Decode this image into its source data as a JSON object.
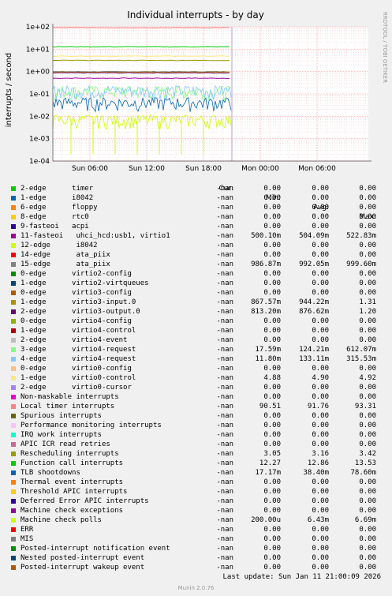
{
  "chart_data": {
    "type": "line",
    "title": "Individual interrupts - by day",
    "ylabel": "interrupts / second",
    "yscale": "log",
    "ylim": [
      0.0001,
      100
    ],
    "y_ticks": [
      "1e-04",
      "1e-03",
      "1e-02",
      "1e-01",
      "1e+00",
      "1e+01",
      "1e+02"
    ],
    "x_ticks": [
      "Sun 06:00",
      "Sun 12:00",
      "Sun 18:00",
      "Mon 00:00",
      "Mon 06:00"
    ],
    "grid": true,
    "series": [
      {
        "name": "2-edge",
        "level": 0
      },
      {
        "name": "11-fasteoi",
        "level": 0.504
      },
      {
        "name": "15-edge",
        "level": 0.992
      },
      {
        "name": "1-edge",
        "level": 0.944
      },
      {
        "name": "2-edge",
        "level": 0.877
      },
      {
        "name": "3-edge",
        "level": 0.124
      },
      {
        "name": "4-edge",
        "level": 0.133
      },
      {
        "name": "1-edge",
        "level": 4.9
      },
      {
        "name": "Local timer interrupts",
        "level": 91.76
      },
      {
        "name": "Rescheduling interrupts",
        "level": 3.16
      },
      {
        "name": "Function call interrupts",
        "level": 12.86
      },
      {
        "name": "TLB shootdowns",
        "level": 0.0384
      },
      {
        "name": "Machine check polls",
        "level": 0.00643
      }
    ]
  },
  "colors": {
    "background": "#f0f0f0",
    "plot_bg": "#ffffff",
    "grid": "#ff8080",
    "now_line": "#b0a0d0"
  },
  "legend": {
    "headers": {
      "cur": "Cur:",
      "min": "Min:",
      "avg": "Avg:",
      "max": "Max:"
    },
    "rows": [
      {
        "label": "2-edge      timer",
        "color": "#00cc00",
        "cur": "-nan",
        "min": "0.00",
        "avg": "0.00",
        "max": "0.00"
      },
      {
        "label": "1-edge      i8042",
        "color": "#0066b3",
        "cur": "-nan",
        "min": "0.00",
        "avg": "0.00",
        "max": "0.00"
      },
      {
        "label": "6-edge      floppy",
        "color": "#ff8000",
        "cur": "-nan",
        "min": "0.00",
        "avg": "0.00",
        "max": "0.00"
      },
      {
        "label": "8-edge      rtc0",
        "color": "#ffcc00",
        "cur": "-nan",
        "min": "0.00",
        "avg": "0.00",
        "max": "0.00"
      },
      {
        "label": "9-fasteoi   acpi",
        "color": "#330099",
        "cur": "-nan",
        "min": "0.00",
        "avg": "0.00",
        "max": "0.00"
      },
      {
        "label": "11-fasteoi   uhci_hcd:usb1, virtio1",
        "color": "#990099",
        "cur": "-nan",
        "min": "500.10m",
        "avg": "504.09m",
        "max": "522.83m"
      },
      {
        "label": "12-edge      i8042",
        "color": "#ccff00",
        "cur": "-nan",
        "min": "0.00",
        "avg": "0.00",
        "max": "0.00"
      },
      {
        "label": "14-edge      ata_piix",
        "color": "#ff0000",
        "cur": "-nan",
        "min": "0.00",
        "avg": "0.00",
        "max": "0.00"
      },
      {
        "label": "15-edge      ata_piix",
        "color": "#808080",
        "cur": "-nan",
        "min": "986.87m",
        "avg": "992.05m",
        "max": "999.60m"
      },
      {
        "label": "0-edge      virtio2-config",
        "color": "#008f00",
        "cur": "-nan",
        "min": "0.00",
        "avg": "0.00",
        "max": "0.00"
      },
      {
        "label": "1-edge      virtio2-virtqueues",
        "color": "#00487d",
        "cur": "-nan",
        "min": "0.00",
        "avg": "0.00",
        "max": "0.00"
      },
      {
        "label": "0-edge      virtio3-config",
        "color": "#b35a00",
        "cur": "-nan",
        "min": "0.00",
        "avg": "0.00",
        "max": "0.00"
      },
      {
        "label": "1-edge      virtio3-input.0",
        "color": "#b38f00",
        "cur": "-nan",
        "min": "867.57m",
        "avg": "944.22m",
        "max": "1.31"
      },
      {
        "label": "2-edge      virtio3-output.0",
        "color": "#6b006b",
        "cur": "-nan",
        "min": "813.20m",
        "avg": "876.62m",
        "max": "1.20"
      },
      {
        "label": "0-edge      virtio4-config",
        "color": "#8fb300",
        "cur": "-nan",
        "min": "0.00",
        "avg": "0.00",
        "max": "0.00"
      },
      {
        "label": "1-edge      virtio4-control",
        "color": "#b30000",
        "cur": "-nan",
        "min": "0.00",
        "avg": "0.00",
        "max": "0.00"
      },
      {
        "label": "2-edge      virtio4-event",
        "color": "#bebebe",
        "cur": "-nan",
        "min": "0.00",
        "avg": "0.00",
        "max": "0.00"
      },
      {
        "label": "3-edge      virtio4-request",
        "color": "#80ff80",
        "cur": "-nan",
        "min": "17.59m",
        "avg": "124.21m",
        "max": "612.07m"
      },
      {
        "label": "4-edge      virtio4-request",
        "color": "#80c9ff",
        "cur": "-nan",
        "min": "11.80m",
        "avg": "133.11m",
        "max": "315.53m"
      },
      {
        "label": "0-edge      virtio0-config",
        "color": "#ffc080",
        "cur": "-nan",
        "min": "0.00",
        "avg": "0.00",
        "max": "0.00"
      },
      {
        "label": "1-edge      virtio0-control",
        "color": "#ffe680",
        "cur": "-nan",
        "min": "4.88",
        "avg": "4.90",
        "max": "4.92"
      },
      {
        "label": "2-edge      virtio0-cursor",
        "color": "#aa80ff",
        "cur": "-nan",
        "min": "0.00",
        "avg": "0.00",
        "max": "0.00"
      },
      {
        "label": "Non-maskable interrupts",
        "color": "#ee00cc",
        "cur": "-nan",
        "min": "0.00",
        "avg": "0.00",
        "max": "0.00"
      },
      {
        "label": "Local timer interrupts",
        "color": "#ff8080",
        "cur": "-nan",
        "min": "90.51",
        "avg": "91.76",
        "max": "93.31"
      },
      {
        "label": "Spurious interrupts",
        "color": "#666600",
        "cur": "-nan",
        "min": "0.00",
        "avg": "0.00",
        "max": "0.00"
      },
      {
        "label": "Performance monitoring interrupts",
        "color": "#ffbfff",
        "cur": "-nan",
        "min": "0.00",
        "avg": "0.00",
        "max": "0.00"
      },
      {
        "label": "IRQ work interrupts",
        "color": "#00ffcc",
        "cur": "-nan",
        "min": "0.00",
        "avg": "0.00",
        "max": "0.00"
      },
      {
        "label": "APIC ICR read retries",
        "color": "#cc6699",
        "cur": "-nan",
        "min": "0.00",
        "avg": "0.00",
        "max": "0.00"
      },
      {
        "label": "Rescheduling interrupts",
        "color": "#999900",
        "cur": "-nan",
        "min": "3.05",
        "avg": "3.16",
        "max": "3.42"
      },
      {
        "label": "Function call interrupts",
        "color": "#00cc00",
        "cur": "-nan",
        "min": "12.27",
        "avg": "12.86",
        "max": "13.53"
      },
      {
        "label": "TLB shootdowns",
        "color": "#0066b3",
        "cur": "-nan",
        "min": "17.17m",
        "avg": "38.40m",
        "max": "78.60m"
      },
      {
        "label": "Thermal event interrupts",
        "color": "#ff8000",
        "cur": "-nan",
        "min": "0.00",
        "avg": "0.00",
        "max": "0.00"
      },
      {
        "label": "Threshold APIC interrupts",
        "color": "#ffcc00",
        "cur": "-nan",
        "min": "0.00",
        "avg": "0.00",
        "max": "0.00"
      },
      {
        "label": "Deferred Error APIC interrupts",
        "color": "#330099",
        "cur": "-nan",
        "min": "0.00",
        "avg": "0.00",
        "max": "0.00"
      },
      {
        "label": "Machine check exceptions",
        "color": "#990099",
        "cur": "-nan",
        "min": "0.00",
        "avg": "0.00",
        "max": "0.00"
      },
      {
        "label": "Machine check polls",
        "color": "#ccff00",
        "cur": "-nan",
        "min": "200.00u",
        "avg": "6.43m",
        "max": "6.69m"
      },
      {
        "label": "ERR",
        "color": "#ff0000",
        "cur": "-nan",
        "min": "0.00",
        "avg": "0.00",
        "max": "0.00"
      },
      {
        "label": "MIS",
        "color": "#808080",
        "cur": "-nan",
        "min": "0.00",
        "avg": "0.00",
        "max": "0.00"
      },
      {
        "label": "Posted-interrupt notification event",
        "color": "#008f00",
        "cur": "-nan",
        "min": "0.00",
        "avg": "0.00",
        "max": "0.00"
      },
      {
        "label": "Nested posted-interrupt event",
        "color": "#00487d",
        "cur": "-nan",
        "min": "0.00",
        "avg": "0.00",
        "max": "0.00"
      },
      {
        "label": "Posted-interrupt wakeup event",
        "color": "#b35a00",
        "cur": "-nan",
        "min": "0.00",
        "avg": "0.00",
        "max": "0.00"
      }
    ]
  },
  "footer": {
    "last_update": "Last update:  Sun Jan 11 21:00:09 2026",
    "version": "Munin 2.0.76",
    "watermark": "RRDTOOL / TOBI OETIKER"
  }
}
